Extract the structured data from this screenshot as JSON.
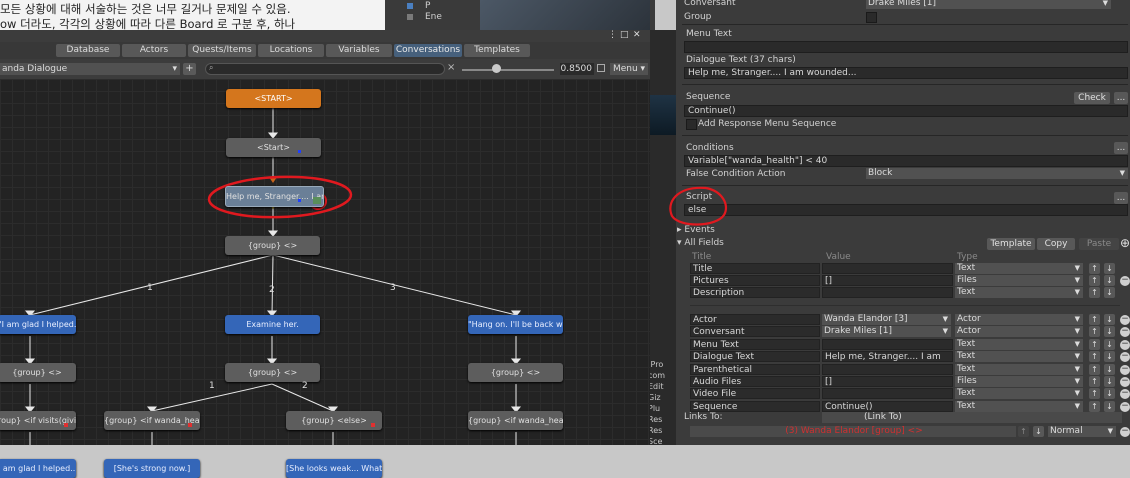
{
  "web_bg": {
    "line1": "모든 상황에 대해 서술하는 것은 너무 길거나 문제일 수 있음.",
    "line2": "ow 더라도, 각각의 상황에 따라 다른 Board 로 구분 후, 하나"
  },
  "hierarchy": {
    "items": [
      "P",
      "Ene"
    ]
  },
  "project_items": [
    ".Pro",
    "com",
    "Edit",
    "Giz",
    "Plu",
    "Res",
    "Res",
    "Sce"
  ],
  "editor": {
    "tabs": [
      "Database",
      "Actors",
      "Quests/Items",
      "Locations",
      "Variables",
      "Conversations",
      "Templates"
    ],
    "active_tab": "Conversations",
    "dialogue_select": "anda Dialogue",
    "add_label": "+",
    "search_icon": "search-icon",
    "clear_label": "×",
    "zoom": "0.8500",
    "menu_label": "Menu",
    "nodes": {
      "start_root": "<START>",
      "start": "<Start>",
      "help": "Help me, Stranger.... I am",
      "group1": "{group} <>",
      "glad": "\"I am glad I helped.\"",
      "examine": "Examine her.",
      "hangon": "\"Hang on. I'll be back wit",
      "group_left": "{group} <>",
      "group_mid": "{group} <>",
      "group_right": "{group} <>",
      "visits": "roup} <if visits(giving_",
      "wanda_health": "{group} <if wanda_health>",
      "else": "{group} <else>",
      "wanda_health_right": "{group} <if wanda_health <",
      "glad2": "I am glad I helped...",
      "strong": "[She's strong now.]",
      "weak": "[She looks weak... What sh"
    },
    "edge_labels": [
      "1",
      "2",
      "3",
      "1",
      "2"
    ]
  },
  "inspector": {
    "conversant_label": "Conversant",
    "conversant_value": "Drake Miles [1]",
    "group_label": "Group",
    "menu_text_label": "Menu Text",
    "menu_text_value": "",
    "dialogue_text_label": "Dialogue Text (37 chars)",
    "dialogue_text_value": "Help me, Stranger.... I am wounded...",
    "sequence_label": "Sequence",
    "check_label": "Check",
    "sequence_value": "Continue()",
    "add_response_label": "Add Response Menu Sequence",
    "conditions_label": "Conditions",
    "conditions_value": "Variable[\"wanda_health\"] < 40",
    "false_cond_label": "False Condition Action",
    "false_cond_value": "Block",
    "script_label": "Script",
    "script_value": "else",
    "ellipsis": "...",
    "events_label": "Events",
    "all_fields_label": "All Fields",
    "template_btn": "Template",
    "copy_btn": "Copy",
    "paste_btn": "Paste",
    "columns": [
      "Title",
      "Value",
      "Type"
    ],
    "fields_a": [
      {
        "title": "Title",
        "value": "",
        "type": "Text"
      },
      {
        "title": "Pictures",
        "value": "[]",
        "type": "Files"
      },
      {
        "title": "Description",
        "value": "",
        "type": "Text"
      }
    ],
    "fields_b": [
      {
        "title": "Actor",
        "value": "Wanda Elandor [3]",
        "type": "Actor",
        "dd": true
      },
      {
        "title": "Conversant",
        "value": "Drake Miles [1]",
        "type": "Actor",
        "dd": true
      },
      {
        "title": "Menu Text",
        "value": "",
        "type": "Text"
      },
      {
        "title": "Dialogue Text",
        "value": "Help me, Stranger.... I am",
        "type": "Text"
      },
      {
        "title": "Parenthetical",
        "value": "",
        "type": "Text"
      },
      {
        "title": "Audio Files",
        "value": "[]",
        "type": "Files"
      },
      {
        "title": "Video File",
        "value": "",
        "type": "Text"
      },
      {
        "title": "Sequence",
        "value": "Continue()",
        "type": "Text"
      }
    ],
    "links_to_label": "Links To:",
    "links_to_value": "(Link To)",
    "link_item": "(3) Wanda Elandor [group] <>",
    "link_mode": "Normal"
  },
  "colors": {
    "annotation_red": "#e0191f",
    "start_orange": "#d4761d",
    "response_blue": "#3466b8"
  }
}
